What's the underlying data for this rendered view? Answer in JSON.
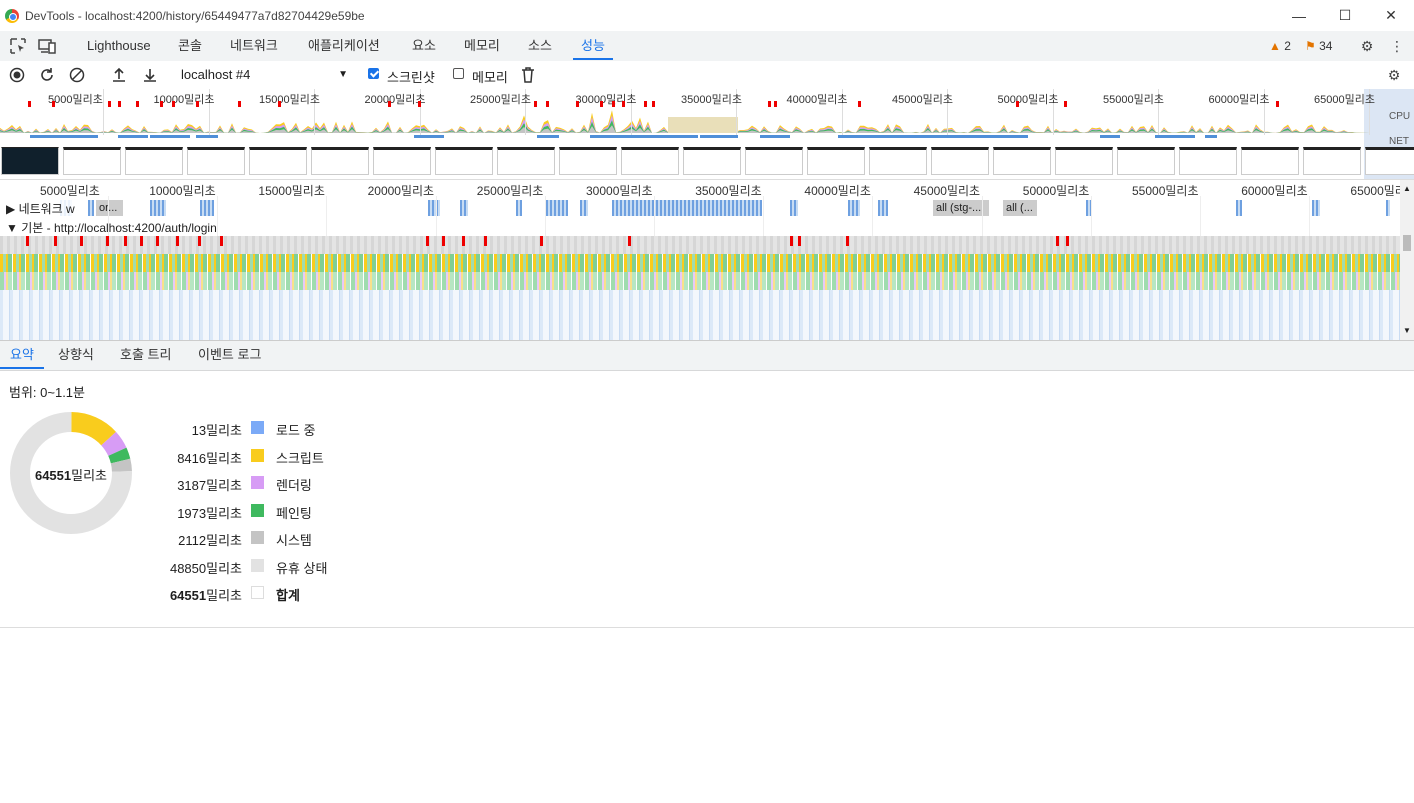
{
  "window": {
    "title": "DevTools - localhost:4200/history/65449477a7d82704429e59be",
    "minimize": "—",
    "maximize": "☐",
    "close": "✕"
  },
  "tabs": [
    {
      "label": "Lighthouse"
    },
    {
      "label": "콘솔"
    },
    {
      "label": "네트워크"
    },
    {
      "label": "애플리케이션"
    },
    {
      "label": "요소"
    },
    {
      "label": "메모리"
    },
    {
      "label": "소스"
    },
    {
      "label": "성능"
    }
  ],
  "status": {
    "warnings": "2",
    "issues": "34"
  },
  "toolbar": {
    "profile_select": "localhost #4",
    "screenshot_label": "스크린샷",
    "screenshot_checked": true,
    "memory_label": "메모리",
    "memory_checked": false
  },
  "overview": {
    "ticks": [
      "5000밀리초",
      "10000밀리초",
      "15000밀리초",
      "20000밀리초",
      "25000밀리초",
      "30000밀리초",
      "35000밀리초",
      "40000밀리초",
      "45000밀리초",
      "50000밀리초",
      "55000밀리초",
      "60000밀리초",
      "65000밀리초"
    ],
    "cpu_label": "CPU",
    "net_label": "NET"
  },
  "timeline": {
    "ticks": [
      "5000밀리초",
      "10000밀리초",
      "15000밀리초",
      "20000밀리초",
      "25000밀리초",
      "30000밀리초",
      "35000밀리초",
      "40000밀리초",
      "45000밀리초",
      "50000밀리초",
      "55000밀리초",
      "60000밀리초",
      "65000밀리초"
    ],
    "network_track": "▶ 네트워크 w",
    "network_chip_1": "or...",
    "network_chip_2": "all (stg-...",
    "network_chip_3": "all (...",
    "main_track": "▼ 기본 - http://localhost:4200/auth/login"
  },
  "bottom_tabs": [
    {
      "label": "요약"
    },
    {
      "label": "상향식"
    },
    {
      "label": "호출 트리"
    },
    {
      "label": "이벤트 로그"
    }
  ],
  "summary": {
    "range": "범위: 0~1.1분",
    "total_value": "64551",
    "total_unit": "밀리초",
    "rows": [
      {
        "value": "13밀리초",
        "label": "로드 중",
        "color": "#7baaf7"
      },
      {
        "value": "8416밀리초",
        "label": "스크립트",
        "color": "#f9cc1d"
      },
      {
        "value": "3187밀리초",
        "label": "렌더링",
        "color": "#d79cf5"
      },
      {
        "value": "1973밀리초",
        "label": "페인팅",
        "color": "#3fb95f"
      },
      {
        "value": "2112밀리초",
        "label": "시스템",
        "color": "#c4c4c4"
      },
      {
        "value": "48850밀리초",
        "label": "유휴 상태",
        "color": "#e2e2e2"
      }
    ],
    "total_row": {
      "value_bold": "64551",
      "value_unit": "밀리초",
      "label": "합계",
      "color": "#ffffff"
    }
  },
  "chart_data": {
    "type": "pie",
    "title": "",
    "categories": [
      "로드 중",
      "스크립트",
      "렌더링",
      "페인팅",
      "시스템",
      "유휴 상태"
    ],
    "values": [
      13,
      8416,
      3187,
      1973,
      2112,
      48850
    ],
    "colors": [
      "#7baaf7",
      "#f9cc1d",
      "#d79cf5",
      "#3fb95f",
      "#c4c4c4",
      "#e2e2e2"
    ]
  }
}
